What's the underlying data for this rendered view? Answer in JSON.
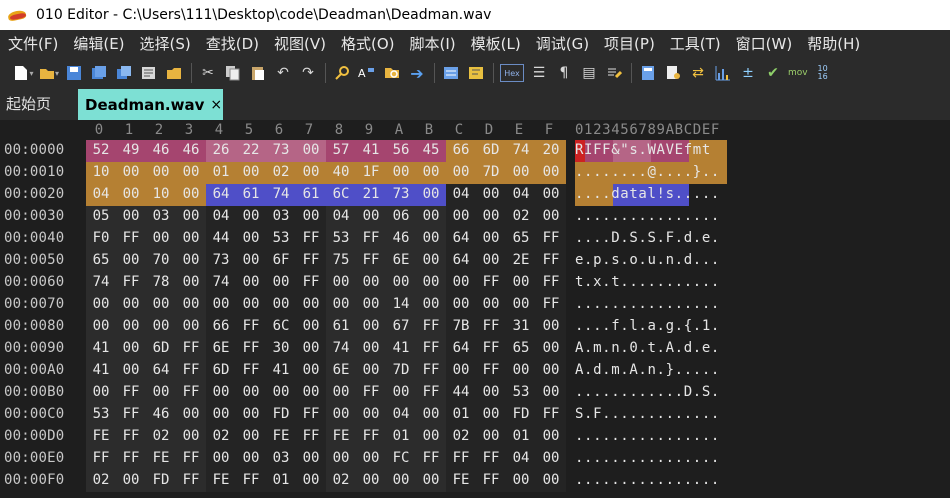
{
  "window": {
    "title": "010 Editor - C:\\Users\\111\\Desktop\\code\\Deadman\\Deadman.wav"
  },
  "menu": [
    "文件(F)",
    "编辑(E)",
    "选择(S)",
    "查找(D)",
    "视图(V)",
    "格式(O)",
    "脚本(I)",
    "模板(L)",
    "调试(G)",
    "项目(P)",
    "工具(T)",
    "窗口(W)",
    "帮助(H)"
  ],
  "toolbar": {
    "hex_label": "Hex",
    "mov_label": "mov",
    "hex_mini_label": "10\n16"
  },
  "tabs": {
    "start": "起始页",
    "active": "Deadman.wav",
    "close": "×"
  },
  "hex": {
    "column_headers": [
      "0",
      "1",
      "2",
      "3",
      "4",
      "5",
      "6",
      "7",
      "8",
      "9",
      "A",
      "B",
      "C",
      "D",
      "E",
      "F"
    ],
    "ascii_header": "0123456789ABCDEF",
    "colors": {
      "riff": "#a5456f",
      "size": "#b56586",
      "wave": "#a5456f",
      "fmt": "#b58033",
      "data": "#4f4fc8",
      "red": "#cc2222"
    },
    "rows": [
      {
        "addr": "00:0000",
        "bytes": [
          "52",
          "49",
          "46",
          "46",
          "26",
          "22",
          "73",
          "00",
          "57",
          "41",
          "56",
          "45",
          "66",
          "6D",
          "74",
          "20"
        ],
        "ascii": "RIFF&\"s.WAVEfmt "
      },
      {
        "addr": "00:0010",
        "bytes": [
          "10",
          "00",
          "00",
          "00",
          "01",
          "00",
          "02",
          "00",
          "40",
          "1F",
          "00",
          "00",
          "00",
          "7D",
          "00",
          "00"
        ],
        "ascii": "........@....}.."
      },
      {
        "addr": "00:0020",
        "bytes": [
          "04",
          "00",
          "10",
          "00",
          "64",
          "61",
          "74",
          "61",
          "6C",
          "21",
          "73",
          "00",
          "04",
          "00",
          "04",
          "00"
        ],
        "ascii": "....datal!s....."
      },
      {
        "addr": "00:0030",
        "bytes": [
          "05",
          "00",
          "03",
          "00",
          "04",
          "00",
          "03",
          "00",
          "04",
          "00",
          "06",
          "00",
          "00",
          "00",
          "02",
          "00"
        ],
        "ascii": "................"
      },
      {
        "addr": "00:0040",
        "bytes": [
          "F0",
          "FF",
          "00",
          "00",
          "44",
          "00",
          "53",
          "FF",
          "53",
          "FF",
          "46",
          "00",
          "64",
          "00",
          "65",
          "FF"
        ],
        "ascii": "....D.S.S.F.d.e."
      },
      {
        "addr": "00:0050",
        "bytes": [
          "65",
          "00",
          "70",
          "00",
          "73",
          "00",
          "6F",
          "FF",
          "75",
          "FF",
          "6E",
          "00",
          "64",
          "00",
          "2E",
          "FF"
        ],
        "ascii": "e.p.s.o.u.n.d..."
      },
      {
        "addr": "00:0060",
        "bytes": [
          "74",
          "FF",
          "78",
          "00",
          "74",
          "00",
          "00",
          "FF",
          "00",
          "00",
          "00",
          "00",
          "00",
          "FF",
          "00",
          "FF"
        ],
        "ascii": "t.x.t..........."
      },
      {
        "addr": "00:0070",
        "bytes": [
          "00",
          "00",
          "00",
          "00",
          "00",
          "00",
          "00",
          "00",
          "00",
          "00",
          "14",
          "00",
          "00",
          "00",
          "00",
          "FF"
        ],
        "ascii": "................"
      },
      {
        "addr": "00:0080",
        "bytes": [
          "00",
          "00",
          "00",
          "00",
          "66",
          "FF",
          "6C",
          "00",
          "61",
          "00",
          "67",
          "FF",
          "7B",
          "FF",
          "31",
          "00"
        ],
        "ascii": "....f.l.a.g.{.1."
      },
      {
        "addr": "00:0090",
        "bytes": [
          "41",
          "00",
          "6D",
          "FF",
          "6E",
          "FF",
          "30",
          "00",
          "74",
          "00",
          "41",
          "FF",
          "64",
          "FF",
          "65",
          "00"
        ],
        "ascii": "A.m.n.0.t.A.d.e."
      },
      {
        "addr": "00:00A0",
        "bytes": [
          "41",
          "00",
          "64",
          "FF",
          "6D",
          "FF",
          "41",
          "00",
          "6E",
          "00",
          "7D",
          "FF",
          "00",
          "FF",
          "00",
          "00"
        ],
        "ascii": "A.d.m.A.n.}....."
      },
      {
        "addr": "00:00B0",
        "bytes": [
          "00",
          "FF",
          "00",
          "FF",
          "00",
          "00",
          "00",
          "00",
          "00",
          "FF",
          "00",
          "FF",
          "44",
          "00",
          "53",
          "00"
        ],
        "ascii": "............D.S."
      },
      {
        "addr": "00:00C0",
        "bytes": [
          "53",
          "FF",
          "46",
          "00",
          "00",
          "00",
          "FD",
          "FF",
          "00",
          "00",
          "04",
          "00",
          "01",
          "00",
          "FD",
          "FF"
        ],
        "ascii": "S.F............."
      },
      {
        "addr": "00:00D0",
        "bytes": [
          "FE",
          "FF",
          "02",
          "00",
          "02",
          "00",
          "FE",
          "FF",
          "FE",
          "FF",
          "01",
          "00",
          "02",
          "00",
          "01",
          "00"
        ],
        "ascii": "................"
      },
      {
        "addr": "00:00E0",
        "bytes": [
          "FF",
          "FF",
          "FE",
          "FF",
          "00",
          "00",
          "03",
          "00",
          "00",
          "00",
          "FC",
          "FF",
          "FF",
          "FF",
          "04",
          "00"
        ],
        "ascii": "................"
      },
      {
        "addr": "00:00F0",
        "bytes": [
          "02",
          "00",
          "FD",
          "FF",
          "FE",
          "FF",
          "01",
          "00",
          "02",
          "00",
          "00",
          "00",
          "FE",
          "FF",
          "00",
          "00"
        ],
        "ascii": "................"
      }
    ]
  }
}
